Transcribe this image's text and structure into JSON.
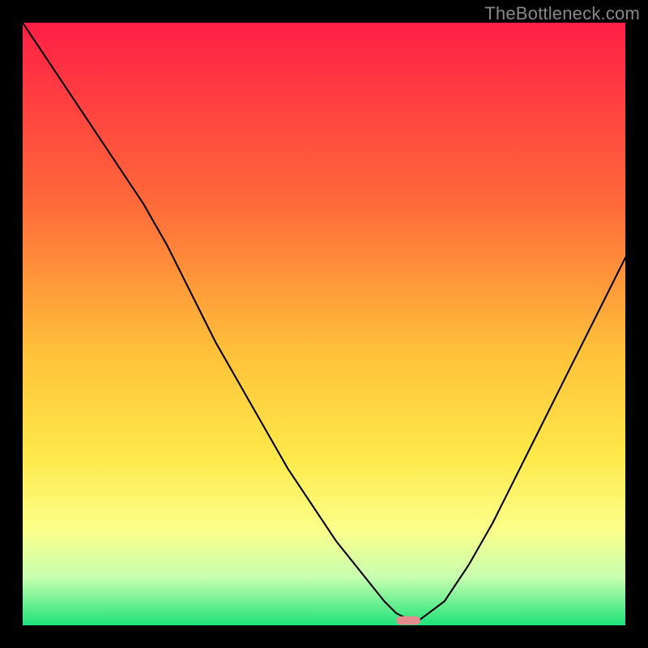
{
  "watermark": "TheBottleneck.com",
  "chart_data": {
    "type": "line",
    "title": "",
    "xlabel": "",
    "ylabel": "",
    "xlim": [
      0,
      100
    ],
    "ylim": [
      0,
      100
    ],
    "gradient_stops": [
      {
        "offset": 0,
        "color": "#ff1f46"
      },
      {
        "offset": 30,
        "color": "#ff6a3a"
      },
      {
        "offset": 55,
        "color": "#ffc23a"
      },
      {
        "offset": 72,
        "color": "#ffe94a"
      },
      {
        "offset": 84,
        "color": "#fcff8a"
      },
      {
        "offset": 92,
        "color": "#c8ffb0"
      },
      {
        "offset": 100,
        "color": "#1fe27a"
      }
    ],
    "series": [
      {
        "name": "bottleneck-curve",
        "color": "#000000",
        "x": [
          0,
          4,
          8,
          12,
          16,
          20,
          24,
          28,
          32,
          36,
          40,
          44,
          48,
          52,
          56,
          60,
          62,
          64,
          66,
          70,
          74,
          78,
          82,
          86,
          90,
          94,
          98,
          100
        ],
        "y": [
          100,
          94,
          88,
          82,
          76,
          70,
          63,
          55,
          47,
          40,
          33,
          26,
          20,
          14,
          9,
          4,
          2,
          1,
          1,
          4,
          10,
          17,
          25,
          33,
          41,
          49,
          57,
          61
        ]
      }
    ],
    "marker": {
      "name": "optimal-point",
      "x": 64,
      "y": 0.8,
      "color": "#e58a8f",
      "width": 4,
      "height": 1.4
    }
  }
}
